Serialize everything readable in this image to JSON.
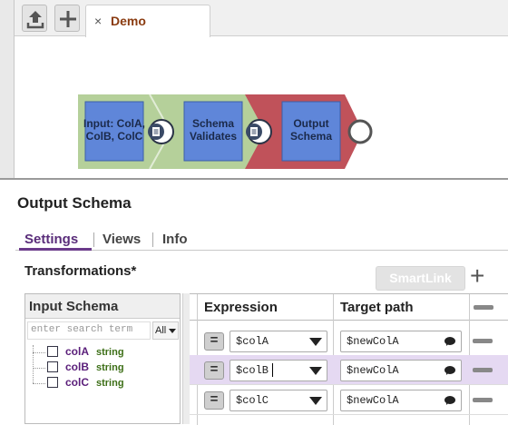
{
  "toolbar": {
    "tab_close": "×",
    "tab_title": "Demo"
  },
  "pipeline": {
    "snaps": [
      {
        "label_lines": [
          "Input: ColA,",
          "ColB, ColC"
        ]
      },
      {
        "label_lines": [
          "Schema",
          "Validates"
        ]
      },
      {
        "label_lines": [
          "Output",
          "Schema"
        ]
      }
    ],
    "colors": {
      "green_band": "#b5d09a",
      "red_band": "#c0525a",
      "snap_fill": "#5f86d9"
    }
  },
  "panel": {
    "title": "Output Schema",
    "tabs": [
      "Settings",
      "Views",
      "Info"
    ],
    "active_tab": "Settings",
    "transformations_label": "Transformations*",
    "smartlink_label": "SmartLink",
    "add_symbol": "+"
  },
  "input_schema": {
    "title": "Input Schema",
    "search_placeholder": "enter search term",
    "filter_value": "All",
    "fields": [
      {
        "name": "colA",
        "type": "string"
      },
      {
        "name": "colB",
        "type": "string"
      },
      {
        "name": "colC",
        "type": "string"
      }
    ]
  },
  "mapping_table": {
    "headers": [
      "Expression",
      "Target path"
    ],
    "rows": [
      {
        "eq": "=",
        "expression": "$colA",
        "target_path": "$newColA",
        "selected": false
      },
      {
        "eq": "=",
        "expression": "$colB",
        "target_path": "$newColA",
        "selected": true
      },
      {
        "eq": "=",
        "expression": "$colC",
        "target_path": "$newColA",
        "selected": false
      }
    ]
  }
}
